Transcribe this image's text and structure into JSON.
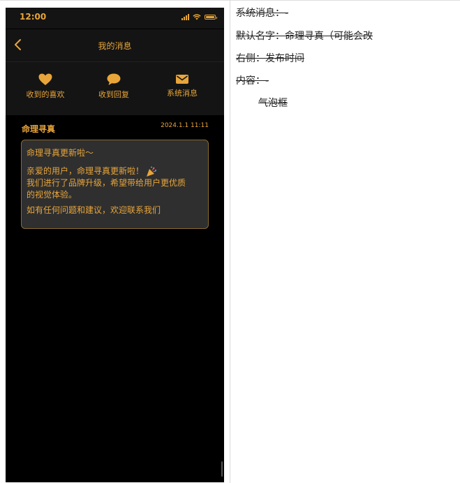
{
  "status_bar": {
    "time": "12:00"
  },
  "nav": {
    "title": "我的消息"
  },
  "tabs": [
    {
      "label": "收到的喜欢",
      "icon": "heart-icon"
    },
    {
      "label": "收到回复",
      "icon": "speech-bubble-icon"
    },
    {
      "label": "系统消息",
      "icon": "envelope-icon"
    }
  ],
  "message": {
    "sender": "命理寻真",
    "time": "2024.1.1 11:11",
    "title": "命理寻真更新啦～",
    "lines": [
      "亲爱的用户，命理寻真更新啦！",
      "我们进行了品牌升级，希望带给用户更优质",
      "的视觉体验。",
      "如有任何问题和建议，欢迎联系我们"
    ]
  },
  "notes": [
    "系统消息：-",
    "默认名字：命理寻真（可能会改",
    "右侧：发布时间",
    "内容：-",
    "气泡框"
  ],
  "colors": {
    "accent": "#e8a53a",
    "background": "#000000",
    "bubble": "#2f2f2f",
    "bar": "#141414"
  }
}
